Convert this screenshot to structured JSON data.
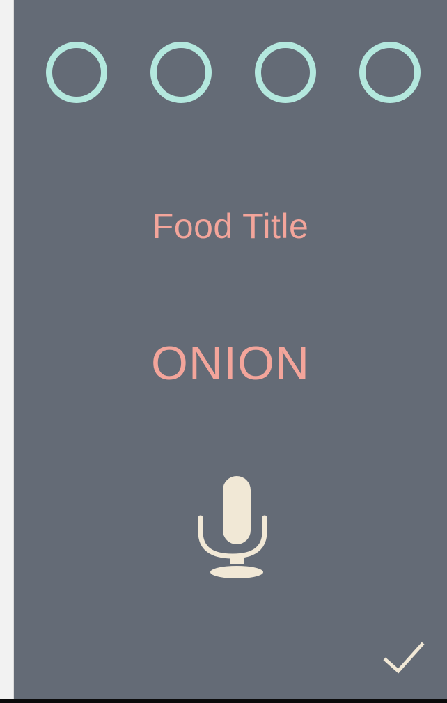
{
  "screen": {
    "background_color": "#646b76",
    "accent_color": "#b4e8de",
    "text_color": "#f3a59b",
    "icon_color": "#f1e8d6"
  },
  "progress": {
    "total_steps": 4,
    "completed_steps": 0
  },
  "food": {
    "title_label": "Food Title",
    "name": "ONION"
  },
  "actions": {
    "record_icon": "microphone-icon",
    "confirm_icon": "checkmark-icon"
  }
}
